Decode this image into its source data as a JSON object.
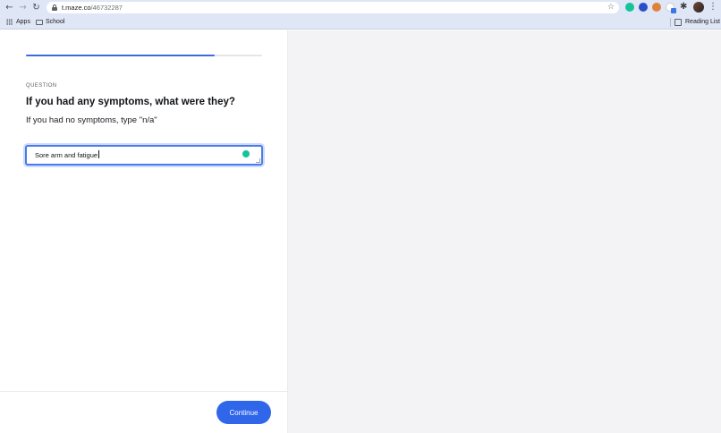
{
  "browser": {
    "url_domain": "t.maze.co",
    "url_path": "/46732287",
    "icons": {
      "back": "←",
      "forward": "→",
      "reload": "↻",
      "star": "☆",
      "extensions": "✱",
      "menu": "⋮"
    },
    "bookmarks": {
      "apps_label": "Apps",
      "school_label": "School",
      "reading_list_label": "Reading List"
    }
  },
  "progress": {
    "fraction": 0.8,
    "color": "#3d6bdb"
  },
  "question": {
    "label": "QUESTION",
    "title": "If you had any symptoms, what were they?",
    "subtitle": "If you had no symptoms, type \"n/a\""
  },
  "answer": {
    "value": "Sore arm and fatigue"
  },
  "footer": {
    "continue_label": "Continue",
    "button_color": "#2f66ea"
  }
}
